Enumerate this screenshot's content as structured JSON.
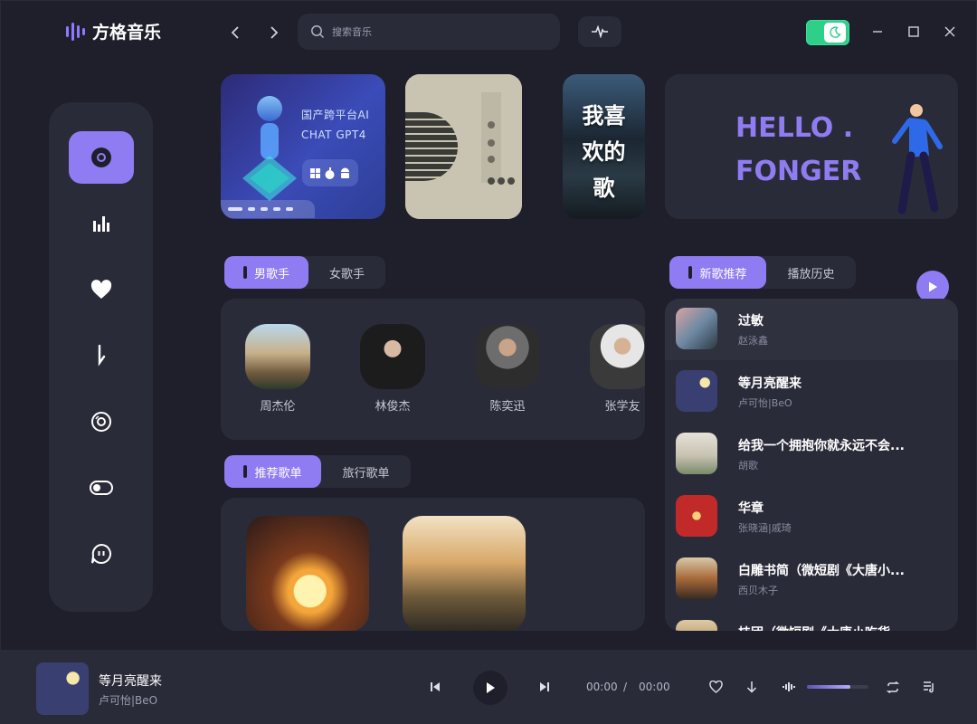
{
  "app": {
    "name": "方格音乐"
  },
  "search": {
    "placeholder": "搜索音乐"
  },
  "banners": {
    "b1_line1": "国产跨平台AI",
    "b1_line2": "CHAT GPT4",
    "b3_text_1": "我喜",
    "b3_text_2": "欢的",
    "b3_text_3": "歌",
    "b4_line1": "HELLO .",
    "b4_line2": "FONGER"
  },
  "artist_tabs": [
    {
      "label": "男歌手",
      "active": true
    },
    {
      "label": "女歌手",
      "active": false
    }
  ],
  "artists": [
    {
      "name": "周杰伦"
    },
    {
      "name": "林俊杰"
    },
    {
      "name": "陈奕迅"
    },
    {
      "name": "张学友"
    }
  ],
  "playlist_tabs": [
    {
      "label": "推荐歌单",
      "active": true
    },
    {
      "label": "旅行歌单",
      "active": false
    }
  ],
  "song_tabs": [
    {
      "label": "新歌推荐",
      "active": true
    },
    {
      "label": "播放历史",
      "active": false
    }
  ],
  "songs": [
    {
      "title": "过敏",
      "artist": "赵泳鑫"
    },
    {
      "title": "等月亮醒来",
      "artist": "卢可怡|BeO"
    },
    {
      "title": "给我一个拥抱你就永远不会...",
      "artist": "胡歌"
    },
    {
      "title": "华章",
      "artist": "张晓涵|戚琦"
    },
    {
      "title": "白雕书简（微短剧《大唐小...",
      "artist": "西贝木子"
    },
    {
      "title": "桂团（微短剧《大唐小吃货",
      "artist": ""
    }
  ],
  "player": {
    "title": "等月亮醒来",
    "artist": "卢可怡|BeO",
    "current_time": "00:00",
    "separator": "/",
    "total_time": "00:00",
    "volume": 0.7
  },
  "colors": {
    "accent": "#8f7cf2",
    "background": "#1e1f2b",
    "panel": "#2a2b39",
    "toggle": "#2fcf8a"
  }
}
